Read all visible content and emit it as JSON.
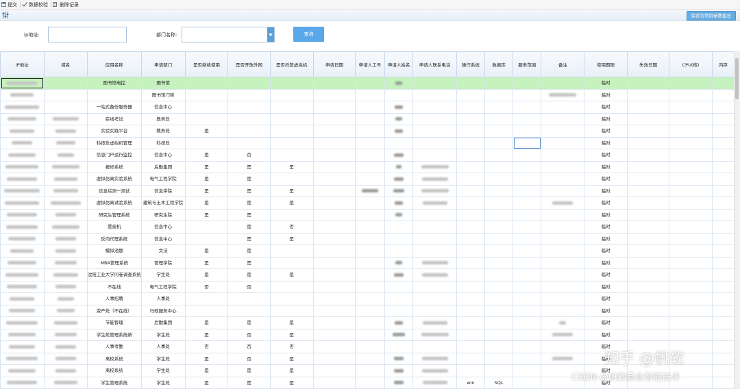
{
  "toolbar": {
    "submit_label": "提交",
    "validate_label": "数据校验",
    "delete_record_label": "删除记录"
  },
  "subbar": {
    "save_common_params_label": "保存为常用参数组合"
  },
  "form": {
    "ip_label": "ip地址:",
    "ip_value": "",
    "dept_label": "部门名称:",
    "dept_value": "",
    "query_label": "查询"
  },
  "table": {
    "columns": [
      "IP地址",
      "域名",
      "应用名称",
      "申请部门",
      "是否继续使用",
      "是否开放外网",
      "是否托管虚拟机",
      "申请日期",
      "申请人工号",
      "申请人姓名",
      "申请人联系电话",
      "操作系统",
      "数据库",
      "服务范围",
      "备注",
      "使用期限",
      "失效日期",
      "CPU(核)",
      "内存"
    ],
    "rows": [
      {
        "app": "图书馆电控",
        "dept": "图书馆",
        "cont": "",
        "ext": "",
        "vm": "",
        "os": "",
        "db": "",
        "term": "临时"
      },
      {
        "app": "",
        "dept": "图书馆门禁",
        "cont": "",
        "ext": "",
        "vm": "",
        "os": "",
        "db": "",
        "term": "临时"
      },
      {
        "app": "一站式备份服务器",
        "dept": "信息中心",
        "cont": "",
        "ext": "",
        "vm": "",
        "os": "",
        "db": "",
        "term": "临时"
      },
      {
        "app": "在线考试",
        "dept": "教务处",
        "cont": "",
        "ext": "",
        "vm": "",
        "os": "",
        "db": "",
        "term": "临时"
      },
      {
        "app": "实验实践平台",
        "dept": "教务处",
        "cont": "是",
        "ext": "",
        "vm": "",
        "os": "",
        "db": "",
        "term": "临时"
      },
      {
        "app": "科技处虚拟机管理",
        "dept": "科技处",
        "cont": "",
        "ext": "",
        "vm": "",
        "os": "",
        "db": "",
        "term": "临时"
      },
      {
        "app": "信息门户运行监控",
        "dept": "信息中心",
        "cont": "是",
        "ext": "否",
        "vm": "",
        "os": "",
        "db": "",
        "term": "临时"
      },
      {
        "app": "报修系统",
        "dept": "后勤集团",
        "cont": "是",
        "ext": "是",
        "vm": "是",
        "os": "",
        "db": "",
        "term": "临时"
      },
      {
        "app": "虚拟仿真实验系统",
        "dept": "电气工程学院",
        "cont": "是",
        "ext": "是",
        "vm": "",
        "os": "",
        "db": "",
        "term": "临时"
      },
      {
        "app": "信息综测一测试",
        "dept": "信息学院",
        "cont": "是",
        "ext": "是",
        "vm": "是",
        "os": "",
        "db": "",
        "term": "临时"
      },
      {
        "app": "虚拟仿真试验系统",
        "dept": "建筑与土木工程学院",
        "cont": "是",
        "ext": "是",
        "vm": "是",
        "os": "",
        "db": "",
        "term": "临时"
      },
      {
        "app": "研究生管理系统",
        "dept": "研究生院",
        "cont": "是",
        "ext": "是",
        "vm": "",
        "os": "",
        "db": "",
        "term": "临时"
      },
      {
        "app": "堡垒机",
        "dept": "信息中心",
        "cont": "",
        "ext": "是",
        "vm": "否",
        "os": "",
        "db": "",
        "term": "临时"
      },
      {
        "app": "反向代理系统",
        "dept": "信息中心",
        "cont": "",
        "ext": "是",
        "vm": "是",
        "os": "",
        "db": "",
        "term": "临时"
      },
      {
        "app": "模拟池题",
        "dept": "文法",
        "cont": "是",
        "ext": "是",
        "vm": "",
        "os": "",
        "db": "",
        "term": "临时"
      },
      {
        "app": "MBA管理系统",
        "dept": "管理学院",
        "cont": "是",
        "ext": "是",
        "vm": "",
        "os": "",
        "db": "",
        "term": "临时"
      },
      {
        "app": "沈阳工业大学问卷调查系统",
        "dept": "学生处",
        "cont": "是",
        "ext": "是",
        "vm": "是",
        "os": "",
        "db": "",
        "term": "临时"
      },
      {
        "app": "不在线",
        "dept": "电气工程学院",
        "cont": "否",
        "ext": "否",
        "vm": "",
        "os": "",
        "db": "",
        "term": "临时"
      },
      {
        "app": "人事招聘",
        "dept": "人事处",
        "cont": "",
        "ext": "",
        "vm": "",
        "os": "",
        "db": "",
        "term": "临时"
      },
      {
        "app": "资产处（不在线）",
        "dept": "行政服务中心",
        "cont": "",
        "ext": "",
        "vm": "",
        "os": "",
        "db": "",
        "term": "临时"
      },
      {
        "app": "节能管理",
        "dept": "后勤集团",
        "cont": "是",
        "ext": "是",
        "vm": "是",
        "os": "",
        "db": "",
        "term": "临时"
      },
      {
        "app": "学生处管理系统新",
        "dept": "学生处",
        "cont": "是",
        "ext": "否",
        "vm": "是",
        "os": "",
        "db": "",
        "term": "临时"
      },
      {
        "app": "人事考勤",
        "dept": "人事处",
        "cont": "否",
        "ext": "否",
        "vm": "否",
        "os": "",
        "db": "",
        "term": "临时"
      },
      {
        "app": "离校系统",
        "dept": "学生处",
        "cont": "是",
        "ext": "否",
        "vm": "是",
        "os": "",
        "db": "",
        "term": "临时"
      },
      {
        "app": "离校系统",
        "dept": "学生处",
        "cont": "是",
        "ext": "是",
        "vm": "是",
        "os": "",
        "db": "",
        "term": "临时"
      },
      {
        "app": "学生管理系统",
        "dept": "学生处",
        "cont": "是",
        "ext": "是",
        "vm": "是",
        "os": "win",
        "db": "SQL",
        "term": "临时"
      }
    ]
  },
  "watermark": {
    "line1": "知乎 @帆软",
    "line2": "CSDN @帆软商业智能技术"
  }
}
